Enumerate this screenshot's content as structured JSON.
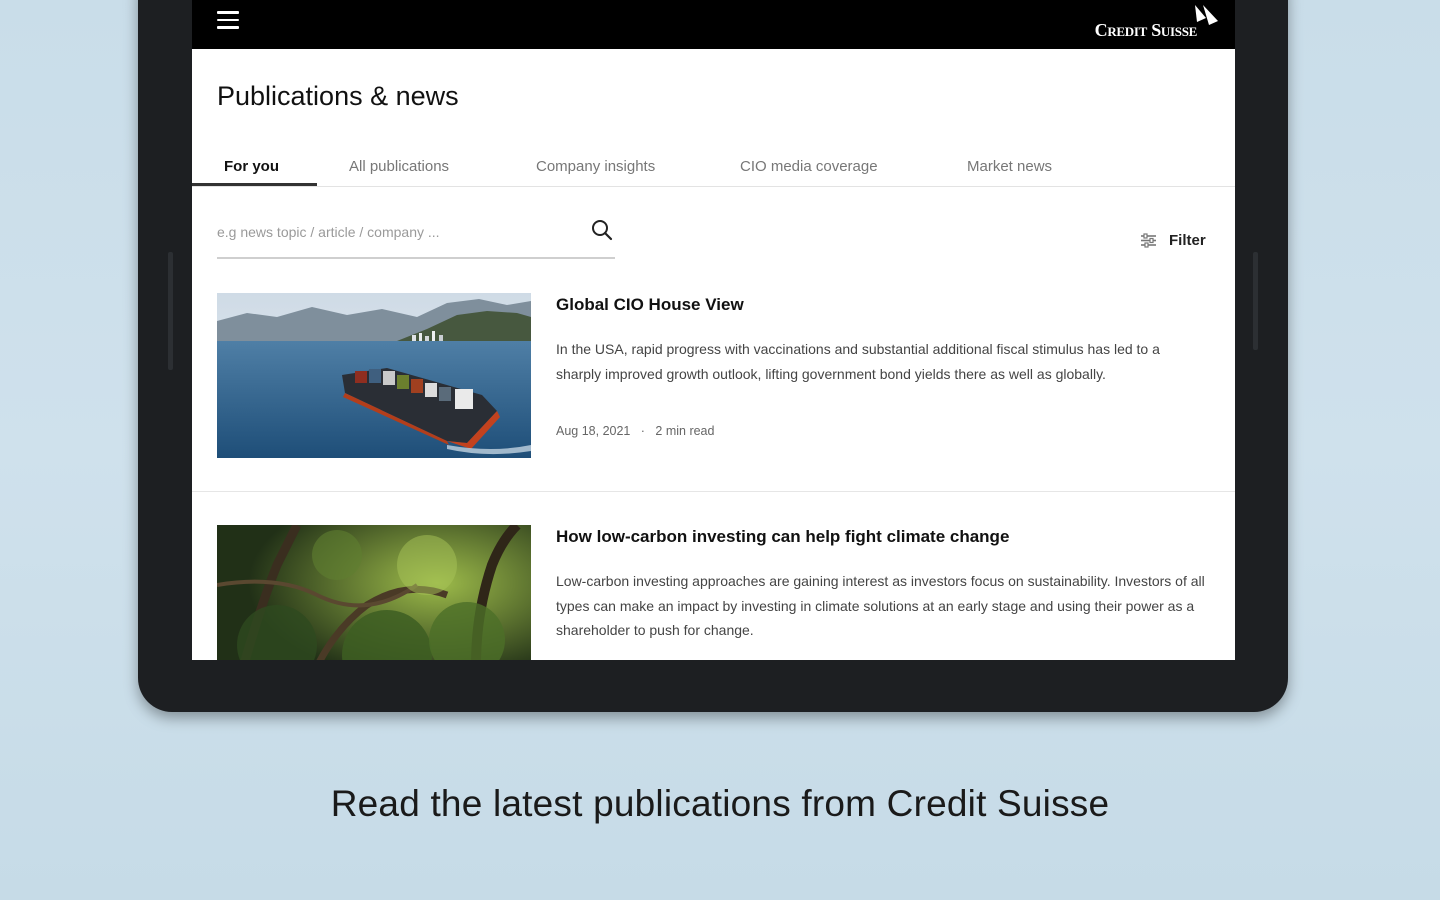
{
  "header": {
    "brand": "Credit Suisse"
  },
  "page": {
    "title": "Publications & news"
  },
  "tabs": [
    {
      "label": "For you",
      "active": true
    },
    {
      "label": "All publications",
      "active": false
    },
    {
      "label": "Company insights",
      "active": false
    },
    {
      "label": "CIO media coverage",
      "active": false
    },
    {
      "label": "Market news",
      "active": false
    }
  ],
  "search": {
    "placeholder": "e.g news topic / article / company ...",
    "value": ""
  },
  "filter": {
    "label": "Filter"
  },
  "articles": [
    {
      "title": "Global CIO House View",
      "summary": "In the USA, rapid progress with vaccinations and substantial additional fiscal stimulus has led to a sharply improved growth outlook, lifting government bond yields there as well as globally.",
      "date": "Aug 18, 2021",
      "read_time": "2 min read",
      "image": "container-ship-photo"
    },
    {
      "title": "How low-carbon investing can help fight climate change",
      "summary": "Low-carbon investing approaches are gaining interest as investors focus on sustainability. Investors of all types can make an impact by investing in climate solutions at an early stage and using their power as a shareholder to push for change.",
      "date": "",
      "read_time": "",
      "image": "forest-photo"
    }
  ],
  "caption": "Read the latest publications from Credit Suisse",
  "icons": {
    "menu": "hamburger-menu-icon",
    "search": "search-icon",
    "filter": "filter-icon",
    "logo": "sails-logo-icon"
  },
  "colors": {
    "topbar": "#000000",
    "background": "#cfe1ec",
    "tablet_frame": "#1d1f22",
    "active_tab_underline": "#333333"
  }
}
